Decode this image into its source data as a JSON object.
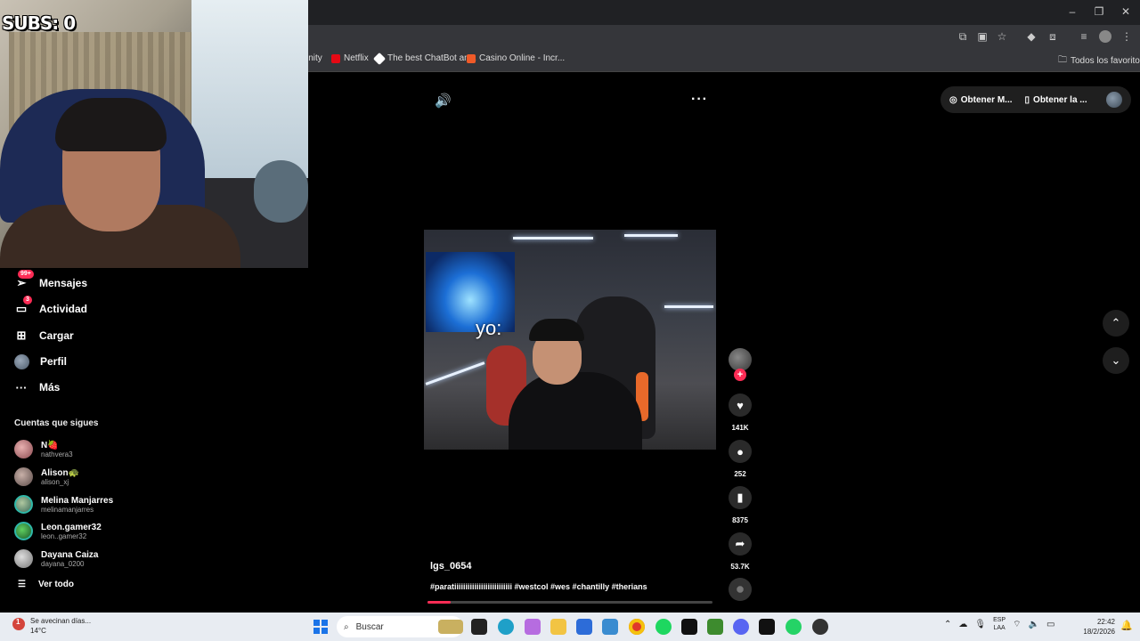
{
  "browser": {
    "bookmarks": [
      {
        "label": "inity"
      },
      {
        "label": "Netflix"
      },
      {
        "label": "The best ChatBot an..."
      },
      {
        "label": "Casino Online - Incr..."
      }
    ],
    "all_favorites": "Todos los favoritos"
  },
  "stream_overlay": {
    "subs": "SUBS: 0"
  },
  "sidebar": {
    "items": [
      {
        "label": "Mensajes",
        "badge": "99+"
      },
      {
        "label": "Actividad",
        "badge": "3"
      },
      {
        "label": "Cargar"
      },
      {
        "label": "Perfil"
      },
      {
        "label": "Más"
      }
    ],
    "following_title": "Cuentas que sigues",
    "accounts": [
      {
        "name": "N🍓",
        "handle": "nathvera3"
      },
      {
        "name": "Alison🐢",
        "handle": "alison_xj"
      },
      {
        "name": "Melina Manjarres",
        "handle": "melinamanjarres"
      },
      {
        "name": "Leon.gamer32",
        "handle": "leon..gamer32"
      },
      {
        "name": "Dayana Caiza",
        "handle": "dayana_0200"
      }
    ],
    "see_all": "Ver todo"
  },
  "topbar": {
    "get_coins": "Obtener M...",
    "get_app": "Obtener la ..."
  },
  "video": {
    "overlay_text": "yo:",
    "author": "lgs_0654",
    "caption": "#paratiiiiiiiiiiiiiiiiiiiiiiiiii #westcol #wes #chantilly #therians",
    "progress": 0.08
  },
  "actions": {
    "likes": "141K",
    "comments": "252",
    "saves": "8375",
    "shares": "53.7K"
  },
  "taskbar": {
    "weather_title": "Se avecinan días...",
    "weather_temp": "14°C",
    "weather_badge": "1",
    "search_placeholder": "Buscar",
    "lang_top": "ESP",
    "lang_bottom": "LAA",
    "time": "22:42",
    "date": "18/2/2026"
  }
}
